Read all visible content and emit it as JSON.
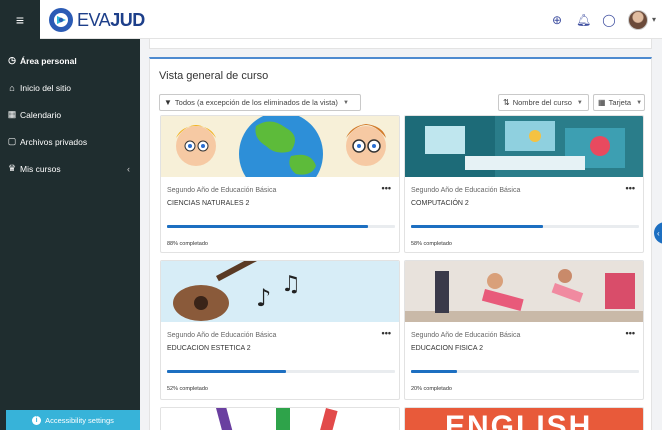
{
  "app": {
    "logo_text_light": "EVA",
    "logo_text_bold": "JUD"
  },
  "topbar": {
    "menu_icon": "hamburger-icon",
    "icons": [
      "globe-icon",
      "bell-icon",
      "chat-icon"
    ],
    "user_menu_caret": "▾"
  },
  "sidebar": {
    "items": [
      {
        "label": "Área personal",
        "icon": "dashboard-icon",
        "active": true
      },
      {
        "label": "Inicio del sitio",
        "icon": "home-icon"
      },
      {
        "label": "Calendario",
        "icon": "calendar-icon"
      },
      {
        "label": "Archivos privados",
        "icon": "files-icon"
      },
      {
        "label": "Mis cursos",
        "icon": "graduation-cap-icon",
        "chevron": "‹"
      }
    ],
    "accessibility_label": "Accessibility settings"
  },
  "main": {
    "title": "Vista general de curso",
    "filter_label": "Todos (a excepción de los eliminados de la vista)",
    "sort_label": "Nombre del curso",
    "view_label": "Tarjeta",
    "courses": [
      {
        "category": "Segundo Año de Educación Básica",
        "name": "CIENCIAS NATURALES 2",
        "progress": 88,
        "progress_label": "88% completado"
      },
      {
        "category": "Segundo Año de Educación Básica",
        "name": "COMPUTACIÓN 2",
        "progress": 58,
        "progress_label": "58% completado"
      },
      {
        "category": "Segundo Año de Educación Básica",
        "name": "EDUCACION ESTETICA 2",
        "progress": 52,
        "progress_label": "52% completado"
      },
      {
        "category": "Segundo Año de Educación Básica",
        "name": "EDUCACION FISICA 2",
        "progress": 20,
        "progress_label": "20% completado"
      }
    ],
    "partial_card_text": "ENGLISH"
  },
  "colors": {
    "sidebar_bg": "#1f2d2f",
    "accent": "#1d6fc1",
    "access_btn": "#37b3d9"
  }
}
